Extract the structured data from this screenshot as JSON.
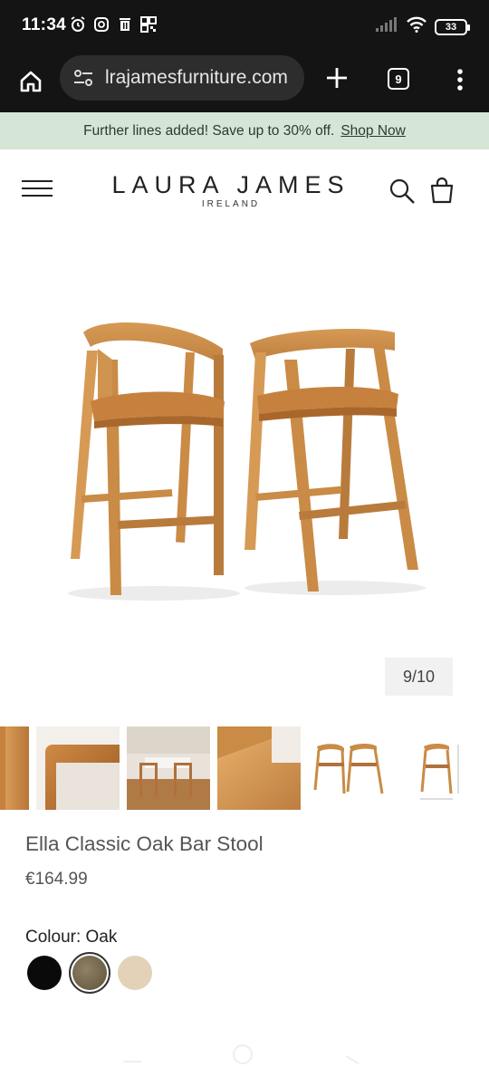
{
  "status_bar": {
    "time": "11:34",
    "battery": "33",
    "icons_left": [
      "alarm-icon",
      "instagram-icon",
      "delete-icon",
      "qr-icon"
    ],
    "icons_right": [
      "signal-icon",
      "wifi-icon",
      "battery-icon"
    ]
  },
  "browser": {
    "url": "lrajamesfurniture.com",
    "tab_count": "9",
    "icons": [
      "home-icon",
      "tune-icon",
      "plus-icon",
      "tabs-icon",
      "more-vert-icon"
    ]
  },
  "announcement": {
    "text": "Further lines added! Save up to 30% off.",
    "link": "Shop Now"
  },
  "header": {
    "brand_name": "LAURA JAMES",
    "brand_sub": "IRELAND",
    "icons": [
      "menu-icon",
      "search-icon",
      "cart-icon"
    ]
  },
  "gallery": {
    "counter": "9/10",
    "thumbnails": [
      "thumb-1",
      "thumb-2",
      "thumb-3",
      "thumb-4",
      "thumb-5",
      "thumb-6"
    ]
  },
  "product": {
    "title": "Ella Classic Oak Bar Stool",
    "price": "€164.99",
    "colour_label": "Colour: Oak",
    "swatches": [
      {
        "name": "Black",
        "color": "#0a0a0a"
      },
      {
        "name": "Oak",
        "color": "#7a6b4e",
        "selected": true
      },
      {
        "name": "Natural",
        "color": "#e3d2b8"
      }
    ]
  },
  "colors": {
    "status_bg": "#141414",
    "announce_bg": "#d5e6d6",
    "wood": "#c98b45"
  }
}
